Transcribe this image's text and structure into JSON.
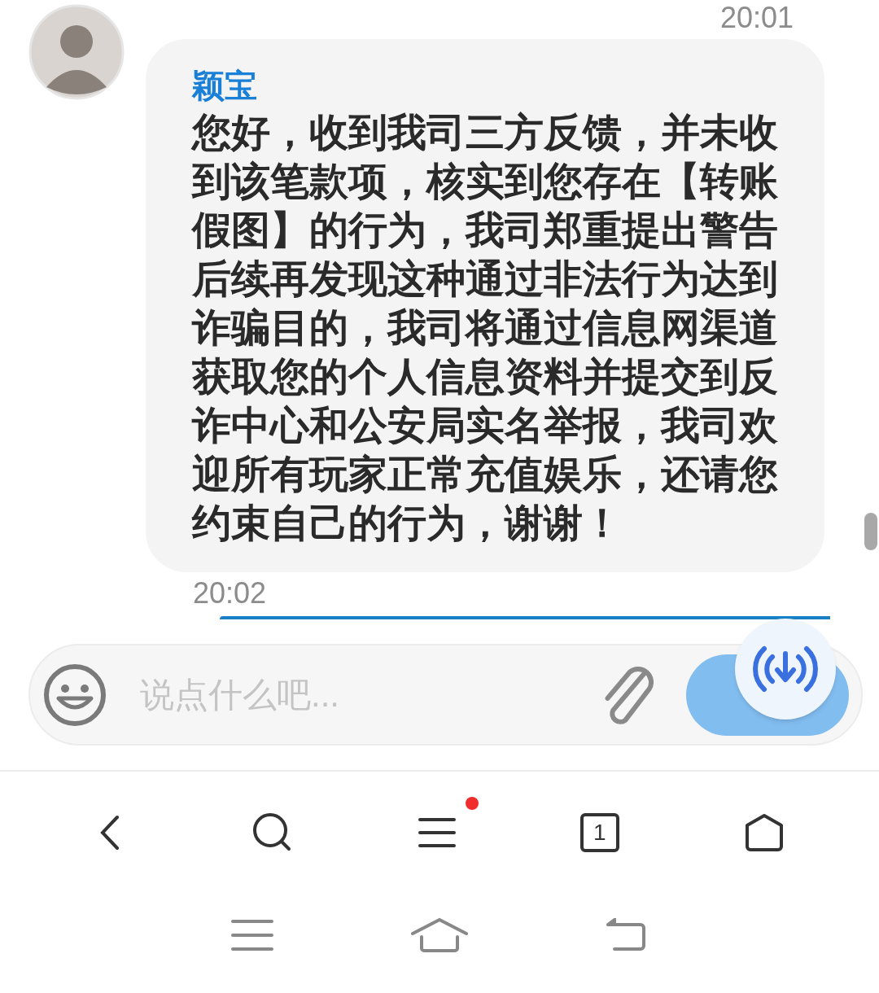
{
  "messages": [
    {
      "time": "20:01",
      "sender": "颖宝",
      "text": "您好，收到我司三方反馈，并未收到该笔款项，核实到您存在【转账假图】的行为，我司郑重提出警告后续再发现这种通过非法行为达到诈骗目的，我司将通过信息网渠道获取您的个人信息资料并提交到反诈中心和公安局实名举报，我司欢迎所有玩家正常充值娱乐，还请您约束自己的行为，谢谢！"
    }
  ],
  "next_time": "20:02",
  "composer": {
    "placeholder": "说点什么吧..."
  },
  "browser_bar": {
    "menu_badge": true,
    "tab_count": "1"
  }
}
